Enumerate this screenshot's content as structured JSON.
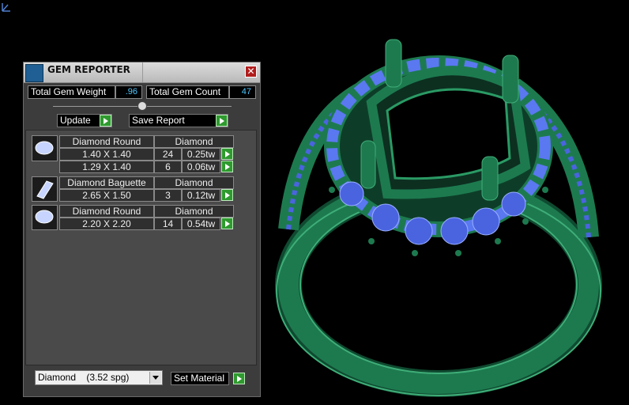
{
  "window": {
    "title": "GEM REPORTER",
    "close_icon": "close-icon"
  },
  "totals": {
    "weight_label": "Total Gem Weight",
    "weight_value": ".96",
    "count_label": "Total Gem Count",
    "count_value": "47"
  },
  "actions": {
    "update_label": "Update",
    "save_label": "Save Report"
  },
  "groups": [
    {
      "icon": "diamond-round-icon",
      "shape": "Diamond Round",
      "material": "Diamond",
      "rows": [
        {
          "size": "1.40 X 1.40",
          "count": "24",
          "weight": "0.25tw"
        },
        {
          "size": "1.29 X 1.40",
          "count": "6",
          "weight": "0.06tw"
        }
      ]
    },
    {
      "icon": "diamond-baguette-icon",
      "shape": "Diamond Baguette",
      "material": "Diamond",
      "rows": [
        {
          "size": "2.65 X 1.50",
          "count": "3",
          "weight": "0.12tw"
        }
      ]
    },
    {
      "icon": "diamond-round-icon",
      "shape": "Diamond Round",
      "material": "Diamond",
      "rows": [
        {
          "size": "2.20 X 2.20",
          "count": "14",
          "weight": "0.54tw"
        }
      ]
    }
  ],
  "material": {
    "selected": "Diamond    (3.52 spg)",
    "set_label": "Set Material"
  },
  "colors": {
    "accent_value": "#4fc8ff",
    "go_button": "#2f9a2f",
    "ring_metal": "#1d7a4f",
    "gems": "#4a64e0"
  }
}
